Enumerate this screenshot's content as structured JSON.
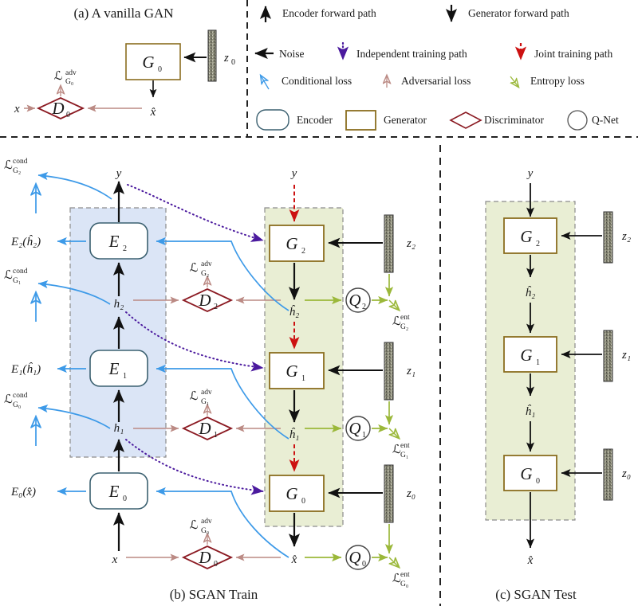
{
  "figure": {
    "captions": {
      "a": "(a) A vanilla GAN",
      "b": "(b) SGAN Train",
      "c": "(c) SGAN Test"
    }
  },
  "colors": {
    "encoder_border": "#3b6070",
    "encoder_fill": "#ffffff",
    "generator_border": "#8a6d1f",
    "generator_fill": "#ffffff",
    "discriminator_border": "#8b1a22",
    "qnet_border": "#444444",
    "encoder_region": "#dbe5f6",
    "generator_region": "#e9eed4",
    "region_border": "#8c8c8c",
    "black_path": "#111111",
    "conditional_loss": "#3d9ae8",
    "adversarial_loss": "#bb8a84",
    "entropy_loss": "#9bb83a",
    "independent_path": "#4b1a9e",
    "joint_path": "#cc1111",
    "noise_bar": "#7a7a6a"
  },
  "legend": {
    "rows": [
      [
        {
          "icon": "arrow-up-black",
          "label": "Encoder forward path"
        },
        {
          "icon": "arrow-down-black",
          "label": "Generator forward path"
        }
      ],
      [
        {
          "icon": "arrow-left-black",
          "label": "Noise"
        },
        {
          "icon": "arrow-down-dotted-purple",
          "label": "Independent training path"
        },
        {
          "icon": "arrow-down-dashed-red",
          "label": "Joint training path"
        }
      ],
      [
        {
          "icon": "arrow-open-blue",
          "label": "Conditional loss"
        },
        {
          "icon": "arrow-open-pink",
          "label": "Adversarial loss"
        },
        {
          "icon": "arrow-open-green",
          "label": "Entropy loss"
        }
      ],
      [
        {
          "icon": "rounded-rect-teal",
          "label": "Encoder"
        },
        {
          "icon": "rect-gold",
          "label": "Generator"
        },
        {
          "icon": "diamond-darkred",
          "label": "Discriminator"
        },
        {
          "icon": "circle-gray",
          "label": "Q-Net"
        }
      ]
    ]
  },
  "panel_a": {
    "generator": "G",
    "generator_sub": "0",
    "discriminator": "D",
    "discriminator_sub": "0",
    "noise": "z",
    "noise_sub": "0",
    "input": "x",
    "output": "x̂",
    "loss": "ℒ",
    "loss_sup": "adv",
    "loss_sub": "G₀"
  },
  "panel_b": {
    "title": "(b) SGAN Train",
    "encoder_column": {
      "nodes": [
        {
          "name": "E",
          "sub": "2"
        },
        {
          "name": "E",
          "sub": "1"
        },
        {
          "name": "E",
          "sub": "0"
        }
      ],
      "signals_top": "y",
      "signals": [
        "h₂",
        "h₁",
        "x"
      ],
      "outputs": [
        "E₂(ĥ₂)",
        "E₁(ĥ₁)",
        "E₀(x̂)"
      ]
    },
    "generator_column": {
      "nodes": [
        {
          "name": "G",
          "sub": "2"
        },
        {
          "name": "G",
          "sub": "1"
        },
        {
          "name": "G",
          "sub": "0"
        }
      ],
      "input_top": "y",
      "signals": [
        "ĥ₂",
        "ĥ₁",
        "x̂"
      ],
      "noise": [
        "z₂",
        "z₁",
        "z₀"
      ]
    },
    "discriminators": [
      {
        "name": "D",
        "sub": "2"
      },
      {
        "name": "D",
        "sub": "1"
      },
      {
        "name": "D",
        "sub": "0"
      }
    ],
    "qnets": [
      {
        "name": "Q",
        "sub": "2"
      },
      {
        "name": "Q",
        "sub": "1"
      },
      {
        "name": "Q",
        "sub": "0"
      }
    ],
    "cond_losses": [
      {
        "base": "ℒ",
        "sup": "cond",
        "sub": "G₂"
      },
      {
        "base": "ℒ",
        "sup": "cond",
        "sub": "G₁"
      },
      {
        "base": "ℒ",
        "sup": "cond",
        "sub": "G₀"
      }
    ],
    "adv_losses": [
      {
        "base": "ℒ",
        "sup": "adv",
        "sub": "G₂"
      },
      {
        "base": "ℒ",
        "sup": "adv",
        "sub": "G₁"
      },
      {
        "base": "ℒ",
        "sup": "adv",
        "sub": "G₀"
      }
    ],
    "ent_losses": [
      {
        "base": "ℒ",
        "sup": "ent",
        "sub": "G₂"
      },
      {
        "base": "ℒ",
        "sup": "ent",
        "sub": "G₁"
      },
      {
        "base": "ℒ",
        "sup": "ent",
        "sub": "G₀"
      }
    ]
  },
  "panel_c": {
    "title": "(c) SGAN Test",
    "input_top": "y",
    "nodes": [
      {
        "name": "G",
        "sub": "2"
      },
      {
        "name": "G",
        "sub": "1"
      },
      {
        "name": "G",
        "sub": "0"
      }
    ],
    "signals": [
      "ĥ₂",
      "ĥ₁"
    ],
    "noise": [
      "z₂",
      "z₁",
      "z₀"
    ],
    "output": "x̂"
  }
}
